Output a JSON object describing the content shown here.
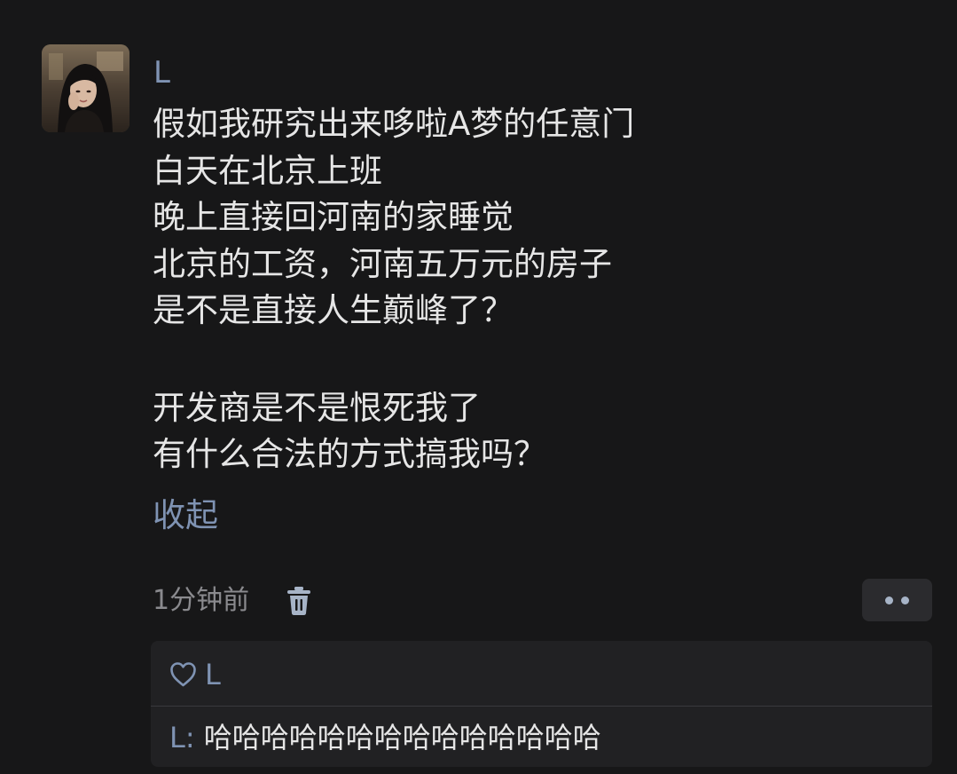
{
  "post": {
    "author": "L",
    "lines": [
      "假如我研究出来哆啦A梦的任意门",
      "白天在北京上班",
      "晚上直接回河南的家睡觉",
      "北京的工资，河南五万元的房子",
      "是不是直接人生巅峰了？",
      "开发商是不是恨死我了",
      "有什么合法的方式搞我吗？"
    ],
    "collapse_label": "收起",
    "timestamp": "1分钟前"
  },
  "interactions": {
    "liked_by": "L",
    "comment": {
      "author": "L",
      "separator": ": ",
      "text": "哈哈哈哈哈哈哈哈哈哈哈哈哈哈"
    }
  },
  "icons": {
    "delete": "trash-icon",
    "more": "more-dots-icon",
    "like": "heart-icon"
  },
  "colors": {
    "background": "#171718",
    "name_link": "#7f93b3",
    "text": "#e6e6e6",
    "muted": "#8a8a8e",
    "panel": "#212123"
  }
}
